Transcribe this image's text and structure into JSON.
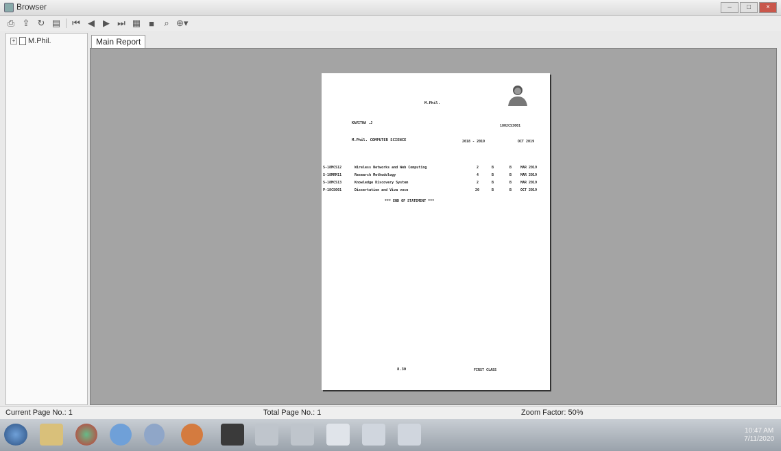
{
  "window": {
    "title": "Browser"
  },
  "tree": {
    "root_label": "M.Phil."
  },
  "tabs": [
    {
      "label": "Main Report"
    }
  ],
  "report": {
    "program": "M.Phil.",
    "student_name": "KAVITHA .J",
    "reg_no": "1802CS3001",
    "subject": "M.Phil. COMPUTER SCIENCE",
    "year": "2018 - 2019",
    "session": "OCT 2019",
    "rows": [
      {
        "code": "S-18MCS12",
        "title": "Wireless Networks and Web Computing",
        "credits": "2",
        "grade": "B",
        "col3": "B",
        "month": "MAR 2019"
      },
      {
        "code": "S-18MRM11",
        "title": "Research Methodology",
        "credits": "4",
        "grade": "B",
        "col3": "B",
        "month": "MAR 2019"
      },
      {
        "code": "S-18MCS13",
        "title": "Knowledge Discovery System",
        "credits": "2",
        "grade": "B",
        "col3": "B",
        "month": "MAR 2019"
      },
      {
        "code": "P-18CS001",
        "title": "Dissertation and Viva voce",
        "credits": "20",
        "grade": "B",
        "col3": "B",
        "month": "OCT 2019"
      }
    ],
    "end_text": "*** END OF STATEMENT ***",
    "cgpa": "8.30",
    "classification": "FIRST CLASS"
  },
  "status": {
    "current_page": "Current Page No.: 1",
    "total_page": "Total Page No.: 1",
    "zoom": "Zoom Factor: 50%"
  },
  "clock": {
    "time": "10:47 AM",
    "date": "7/11/2020"
  },
  "toolbar_icons": [
    "print-icon",
    "export-icon",
    "refresh-icon",
    "tree-toggle-icon",
    "first-page-icon",
    "prev-page-icon",
    "next-page-icon",
    "last-page-icon",
    "page-icon",
    "stop-icon",
    "find-icon",
    "zoom-icon"
  ],
  "colors": {
    "viewer_bg": "#a4a4a4",
    "taskbar": "#9aa2ab"
  }
}
